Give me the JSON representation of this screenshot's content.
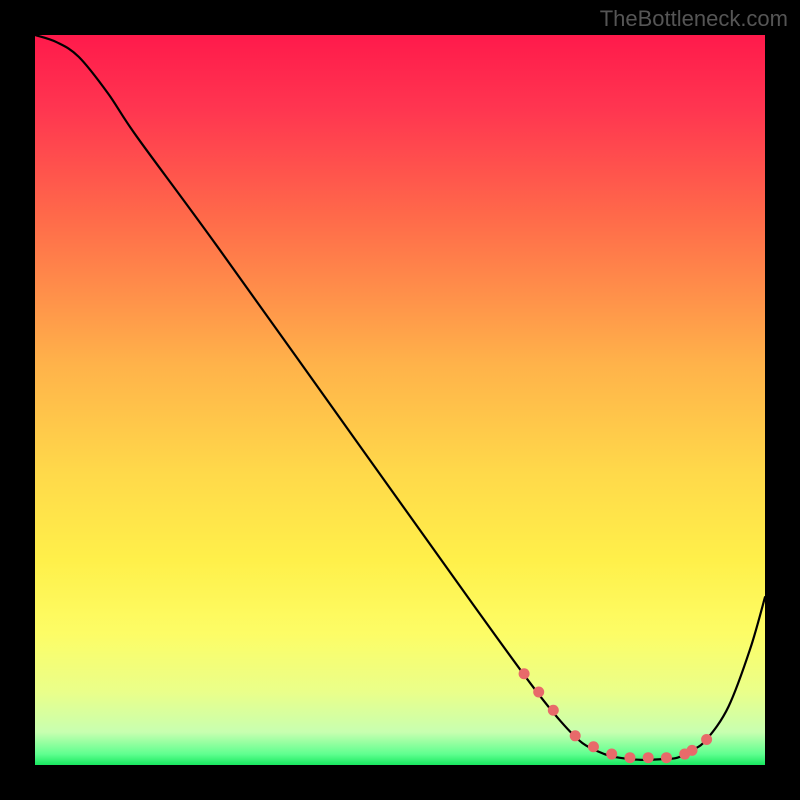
{
  "watermark": "TheBottleneck.com",
  "chart_data": {
    "type": "line",
    "title": "",
    "xlabel": "",
    "ylabel": "",
    "xlim": [
      0,
      100
    ],
    "ylim": [
      0,
      100
    ],
    "series": [
      {
        "name": "bottleneck-curve",
        "x": [
          0,
          3,
          6,
          10,
          14,
          25,
          45,
          60,
          68,
          72,
          75,
          78,
          80,
          83,
          86,
          88,
          90,
          92,
          95,
          98,
          100
        ],
        "values": [
          100,
          99,
          97,
          92,
          86,
          71,
          43,
          22,
          11,
          6,
          3,
          1.5,
          1,
          0.7,
          0.8,
          1,
          2,
          3.5,
          8,
          16,
          23
        ]
      }
    ],
    "markers": {
      "name": "highlight-dots",
      "color": "#e86a6a",
      "x": [
        67,
        69,
        71,
        74,
        76.5,
        79,
        81.5,
        84,
        86.5,
        89,
        90,
        92
      ],
      "values": [
        12.5,
        10,
        7.5,
        4,
        2.5,
        1.5,
        1,
        1,
        1,
        1.5,
        2,
        3.5
      ]
    },
    "gradient_stops": [
      {
        "offset": 0.0,
        "color": "#ff1a4b"
      },
      {
        "offset": 0.1,
        "color": "#ff3550"
      },
      {
        "offset": 0.25,
        "color": "#ff6a4a"
      },
      {
        "offset": 0.45,
        "color": "#ffb24a"
      },
      {
        "offset": 0.6,
        "color": "#ffd94a"
      },
      {
        "offset": 0.72,
        "color": "#fff04a"
      },
      {
        "offset": 0.82,
        "color": "#fdfd66"
      },
      {
        "offset": 0.9,
        "color": "#eaff8a"
      },
      {
        "offset": 0.955,
        "color": "#c8ffb0"
      },
      {
        "offset": 0.985,
        "color": "#60ff90"
      },
      {
        "offset": 1.0,
        "color": "#18e860"
      }
    ]
  }
}
